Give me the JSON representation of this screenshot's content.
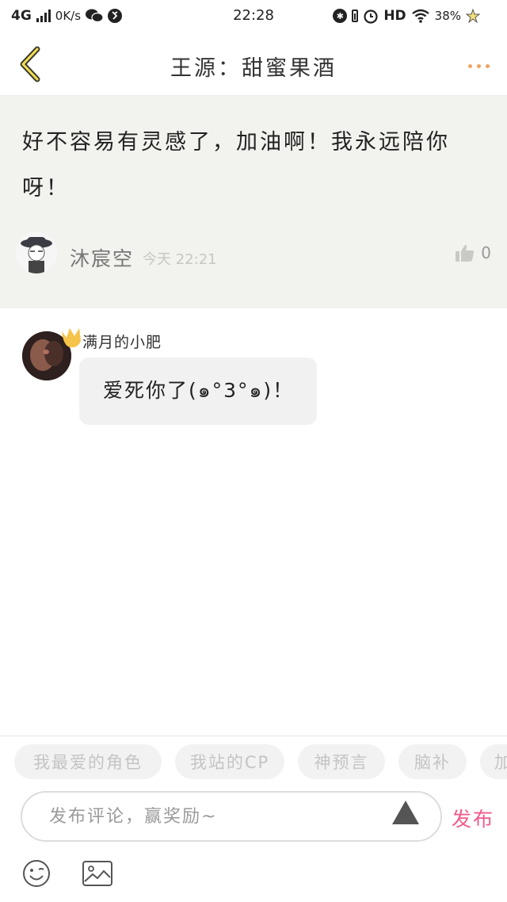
{
  "status_bar": {
    "network": "4G",
    "speed": "0K/s",
    "time": "22:28",
    "hd": "HD",
    "battery": "38%"
  },
  "header": {
    "title": "王源：甜蜜果酒",
    "back_icon": "chevron-left-icon",
    "more_icon": "more-dots-icon",
    "accent_color": "#f0a460"
  },
  "post": {
    "text": "好不容易有灵感了，加油啊！我永远陪你呀！",
    "author": "沐宸空",
    "time": "今天 22:21",
    "likes": "0"
  },
  "comment": {
    "user": "满月的小肥",
    "text": "爱死你了(๑°3°๑)！"
  },
  "tags": [
    "我最爱的角色",
    "我站的CP",
    "神预言",
    "脑补",
    "加"
  ],
  "input": {
    "placeholder": "发布评论，赢奖励~",
    "publish_label": "发布",
    "publish_color": "#f05a8a"
  },
  "toolbar": {
    "emoji_icon": "smiley-icon",
    "image_icon": "image-icon"
  }
}
